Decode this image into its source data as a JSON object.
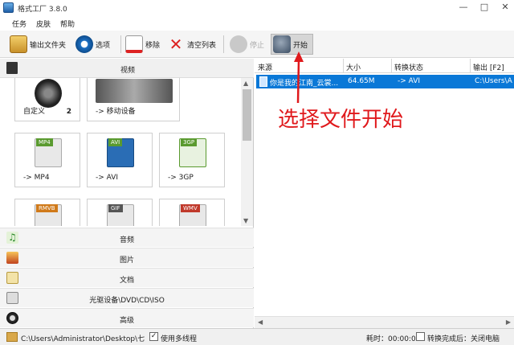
{
  "window": {
    "title": "格式工厂 3.8.0",
    "controls": [
      "—",
      "□",
      "✕"
    ]
  },
  "menu": [
    "任务",
    "皮肤",
    "帮助"
  ],
  "toolbar": {
    "output_folder": "输出文件夹",
    "options": "选项",
    "remove": "移除",
    "clear_list": "清空列表",
    "stop": "停止",
    "start": "开始"
  },
  "left": {
    "video_header": "视频",
    "tiles": [
      {
        "label": "自定义",
        "extra": "2"
      },
      {
        "label": "-> 移动设备"
      },
      {
        "label": "-> MP4",
        "tag": "MP4"
      },
      {
        "label": "-> AVI",
        "tag": "AVI"
      },
      {
        "label": "-> 3GP",
        "tag": "3GP"
      },
      {
        "label": "",
        "tag": "RMVB"
      },
      {
        "label": "",
        "tag": "GIF"
      },
      {
        "label": "",
        "tag": "WMV"
      }
    ],
    "categories": [
      "音频",
      "图片",
      "文档",
      "光驱设备\\DVD\\CD\\ISO",
      "高级"
    ]
  },
  "table": {
    "headers": [
      "来源",
      "大小",
      "转换状态",
      "输出 [F2]"
    ],
    "rows": [
      {
        "source": "你是我的江南_云裳...",
        "size": "64.65M",
        "status": "-> AVI",
        "output": "C:\\Users\\A"
      }
    ]
  },
  "annotation": "选择文件开始",
  "status": {
    "path": "C:\\Users\\Administrator\\Desktop\\七",
    "multithread": "使用多线程",
    "elapsed": "耗时：00:00:00",
    "shutdown": "转换完成后：关闭电脑"
  },
  "colors": {
    "selection": "#0a78d7",
    "annotation": "#e0191c"
  }
}
